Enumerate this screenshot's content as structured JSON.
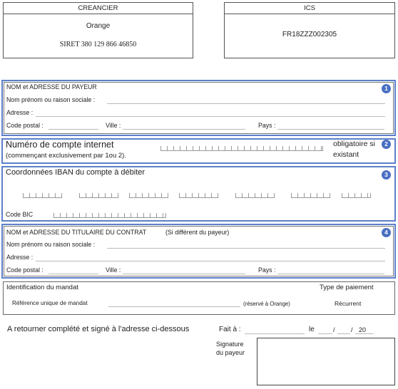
{
  "creancier": {
    "header": "CREANCIER",
    "name": "Orange",
    "siret": "SIRET 380 129 866 46850"
  },
  "ics": {
    "header": "ICS",
    "value": "FR18ZZZ002305"
  },
  "section1": {
    "number": "1",
    "title": "NOM et ADRESSE DU PAYEUR",
    "name_label": "Nom prénom ou raison sociale :",
    "address_label": "Adresse :",
    "postal_label": "Code postal :",
    "city_label": "Ville :",
    "country_label": "Pays :"
  },
  "section2": {
    "number": "2",
    "title": "Numéro de compte internet",
    "subtitle": "(commençant exclusivement par 1ou 2).",
    "note_line1": "obligatoire si",
    "note_line2": "existant"
  },
  "section3": {
    "number": "3",
    "title": "Coordonnées IBAN du compte à débiter",
    "bic_label": "Code BIC"
  },
  "section4": {
    "number": "4",
    "title": "NOM et ADRESSE DU TITULAIRE DU CONTRAT",
    "title_note": "(Si différent du payeur)",
    "name_label": "Nom prénom ou raison sociale :",
    "address_label": "Adresse :",
    "postal_label": "Code postal :",
    "city_label": "Ville :",
    "country_label": "Pays :"
  },
  "mandate": {
    "title": "Identification du mandat",
    "reference_label": "Référence unique de mandat",
    "reserved_note": "(réservé à Orange)",
    "payment_type_title": "Type de paiement",
    "payment_type_value": "Récurrent"
  },
  "footer": {
    "return_text": "A retourner complété et signé à l'adresse ci-dessous",
    "made_at_label": "Fait à :",
    "date_prefix": "le",
    "date_sep1": "/",
    "date_sep2": "/",
    "date_year": "20",
    "signature_line1": "Signature",
    "signature_line2": "du payeur"
  },
  "colors": {
    "accent_blue": "#5b7fc9",
    "badge_blue": "#4a6fc2"
  }
}
